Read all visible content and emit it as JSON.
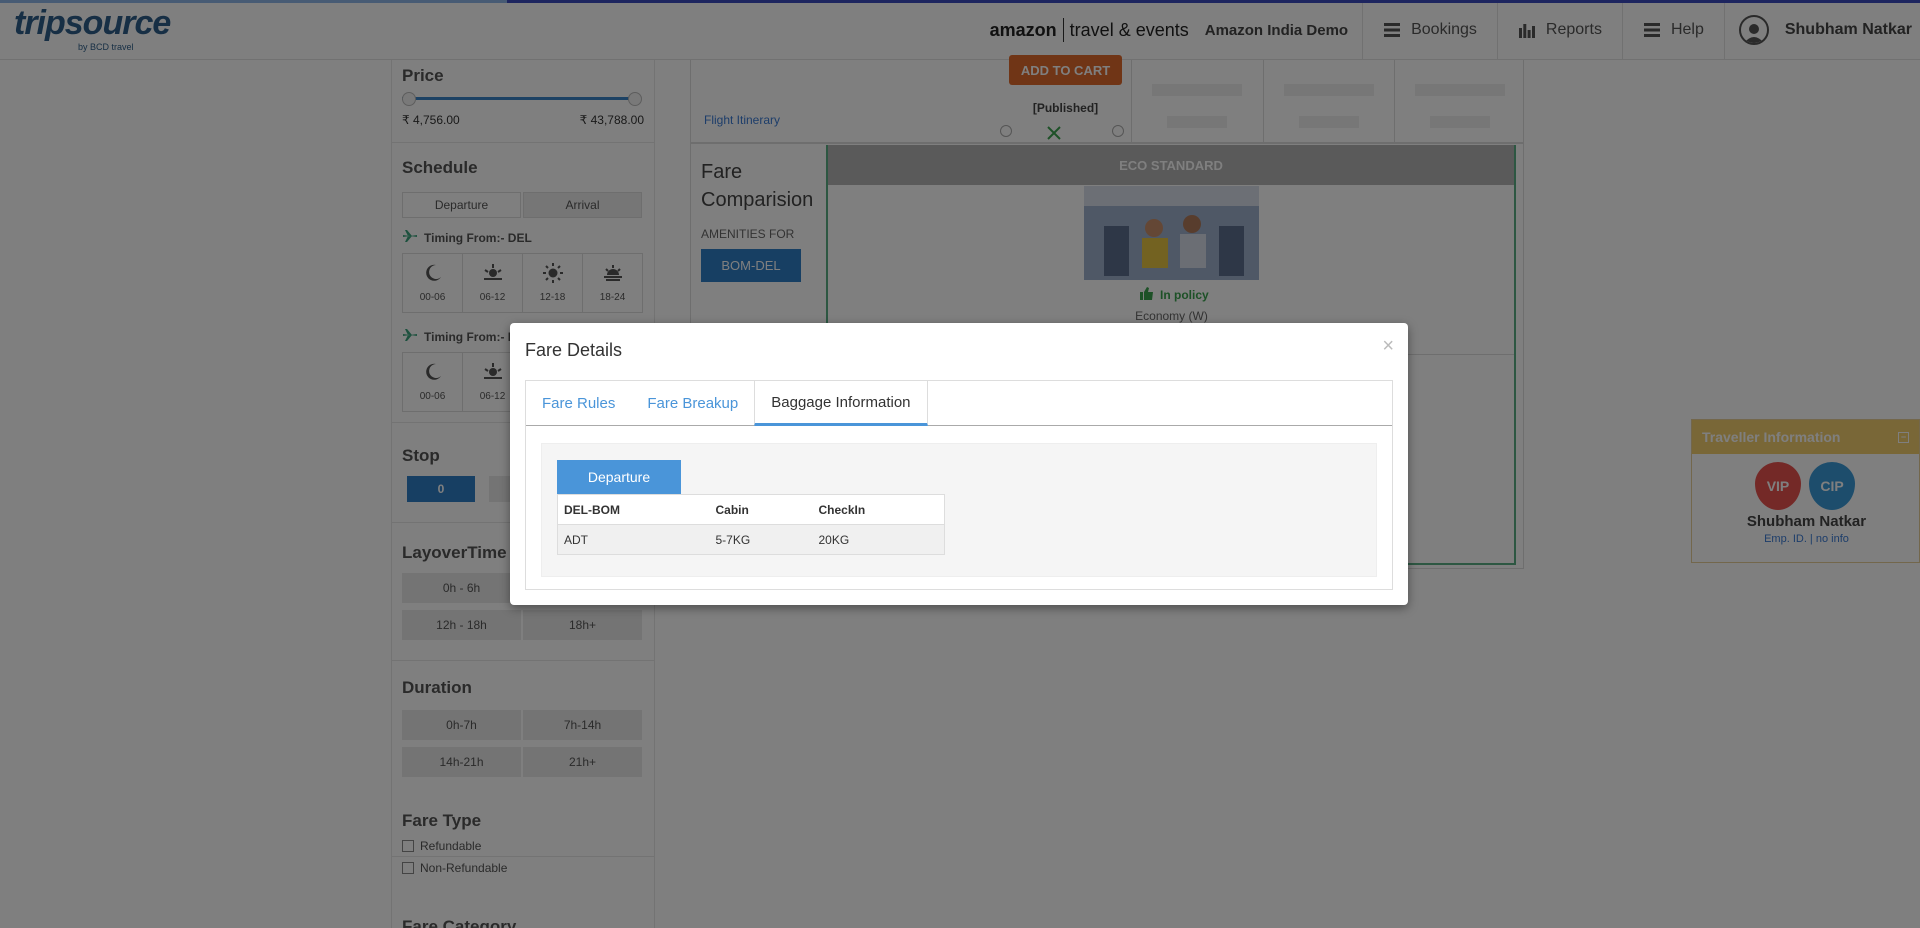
{
  "progress": {
    "fill_fraction": 0.264
  },
  "logo": {
    "main": "tripsource",
    "sub": "by BCD travel"
  },
  "header": {
    "brand_left": "amazon",
    "brand_right": "travel & events",
    "company": "Amazon India Demo",
    "nav": [
      {
        "label": "Bookings",
        "icon": "menu-icon"
      },
      {
        "label": "Reports",
        "icon": "bar-chart-icon"
      },
      {
        "label": "Help",
        "icon": "menu-icon"
      }
    ],
    "user_name": "Shubham Natkar"
  },
  "filters": {
    "price": {
      "title": "Price",
      "min_label": "₹ 4,756.00",
      "max_label": "₹ 43,788.00"
    },
    "schedule": {
      "title": "Schedule",
      "tabs": [
        "Departure",
        "Arrival"
      ],
      "timing1_label": "Timing From:- DEL",
      "timing2_label": "Timing From:- B",
      "slots": [
        "00-06",
        "06-12",
        "12-18",
        "18-24"
      ]
    },
    "stop": {
      "title": "Stop",
      "first": "0"
    },
    "layover": {
      "title": "LayoverTime",
      "options": [
        "0h - 6h",
        "",
        "12h - 18h",
        "18h+"
      ]
    },
    "duration": {
      "title": "Duration",
      "options": [
        "0h-7h",
        "7h-14h",
        "14h-21h",
        "21h+"
      ]
    },
    "fare_type": {
      "title": "Fare Type",
      "options": [
        "Refundable",
        "Non-Refundable"
      ]
    },
    "fare_category": {
      "title": "Fare Category"
    }
  },
  "itinerary": {
    "add_to_cart": "ADD TO CART",
    "published": "[Published]",
    "link": "Flight Itinerary"
  },
  "fare_comparison": {
    "title": "Fare Comparision",
    "amenities_label": "AMENITIES FOR",
    "route_button": "BOM-DEL",
    "column_title": "ECO STANDARD",
    "policy": "In policy",
    "cabin_class": "Economy (W)"
  },
  "traveller": {
    "title": "Traveller Information",
    "tags": [
      {
        "label": "VIP",
        "color": "#e8524f"
      },
      {
        "label": "CIP",
        "color": "#3a9ad9"
      }
    ],
    "name": "Shubham Natkar",
    "emp": "Emp. ID. | no info"
  },
  "modal": {
    "title": "Fare Details",
    "close": "×",
    "tabs": [
      "Fare Rules",
      "Fare Breakup",
      "Baggage Information"
    ],
    "active_tab": "Baggage Information",
    "direction_button": "Departure",
    "table": {
      "headers": [
        "DEL-BOM",
        "Cabin",
        "CheckIn"
      ],
      "rows": [
        [
          "ADT",
          "5-7KG",
          "20KG"
        ]
      ]
    }
  },
  "colors": {
    "accent_blue": "#4a95d9",
    "add_cart": "#e06b2d",
    "traveller_header": "#f3cf6f",
    "policy_green": "#3aa24e"
  }
}
